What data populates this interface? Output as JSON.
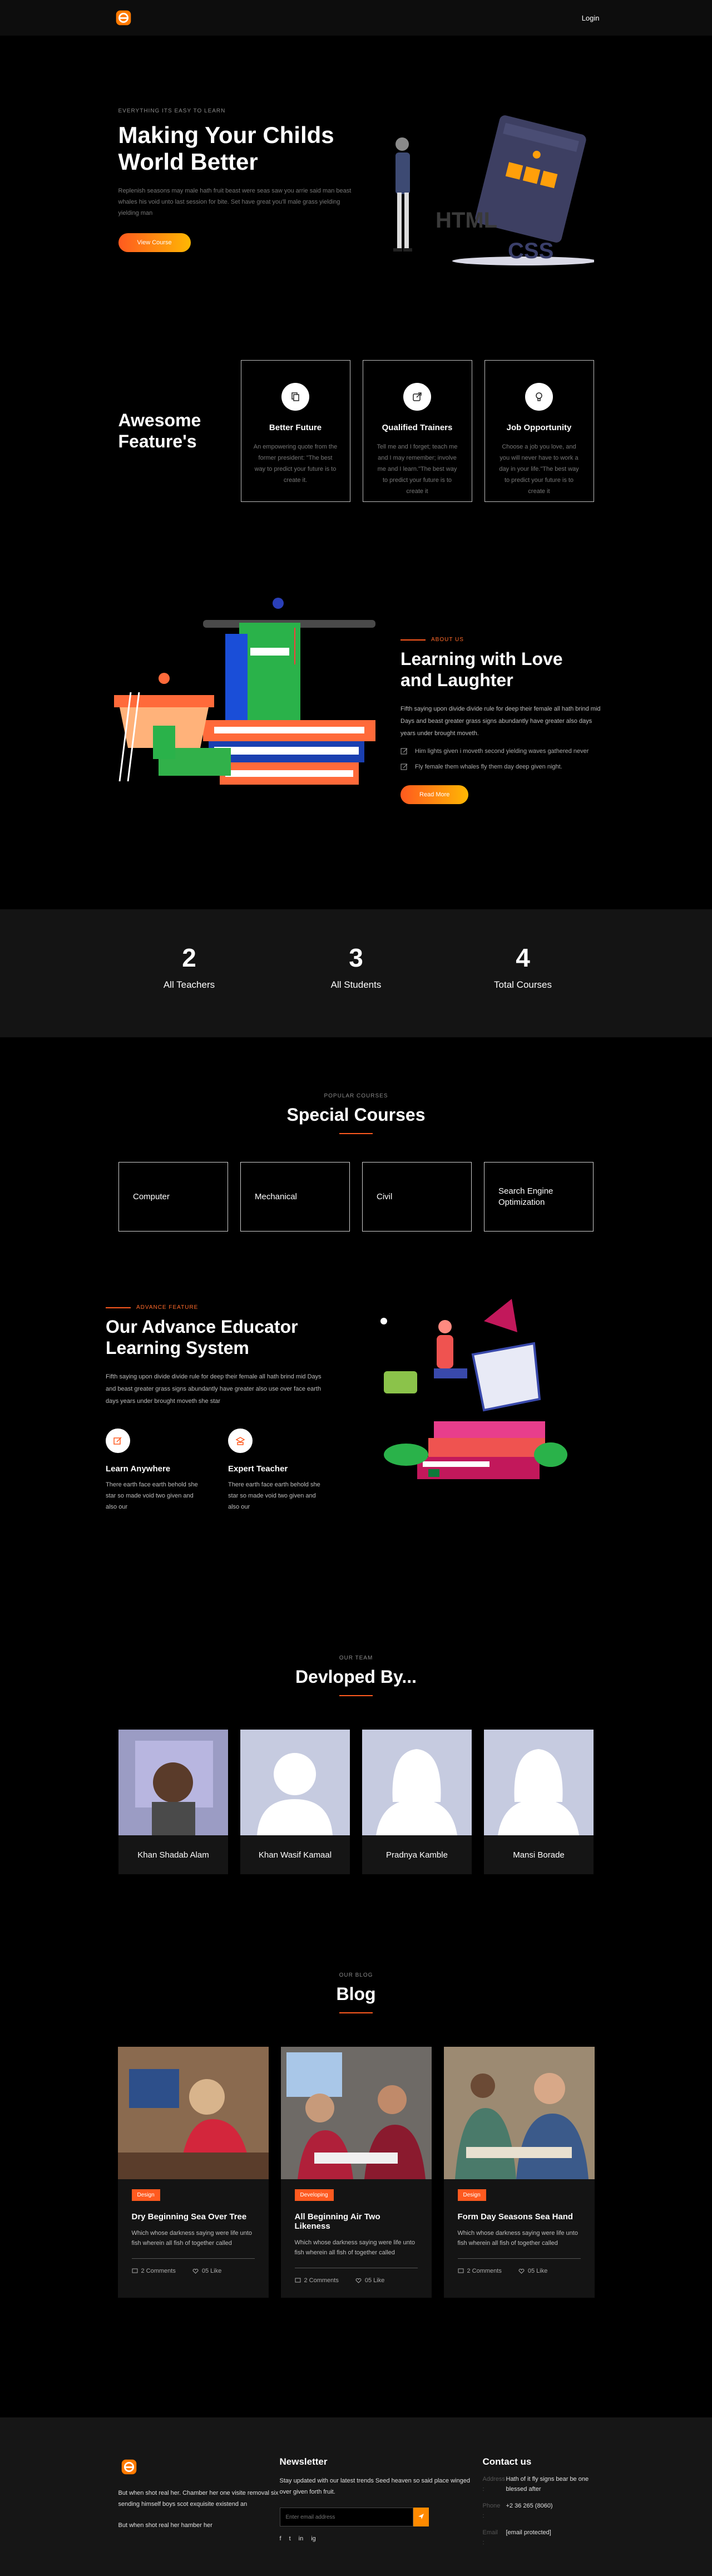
{
  "header": {
    "login": "Login"
  },
  "hero": {
    "eyebrow": "EVERYTHING ITS EASY TO LEARN",
    "title_line1": "Making Your Childs",
    "title_line2": "World Better",
    "text": "Replenish seasons may male hath fruit beast were seas saw you arrie said man beast whales his void unto last session for bite. Set have great you'll male grass yielding yielding man",
    "button": "View Course",
    "art_html": "HTML",
    "art_css": "CSS"
  },
  "features": {
    "title_line1": "Awesome",
    "title_line2": "Feature's",
    "cards": [
      {
        "title": "Better Future",
        "text": "An empowering quote from the former president: \"The best way to predict your future is to create it.",
        "icon": "copy-icon"
      },
      {
        "title": "Qualified Trainers",
        "text": "Tell me and I forget; teach me and I may remember; involve me and I learn.\"The best way to predict your future is to create it",
        "icon": "external-link-icon"
      },
      {
        "title": "Job Opportunity",
        "text": "Choose a job you love, and you will never have to work a day in your life.\"The best way to predict your future is to create it",
        "icon": "lightbulb-icon"
      }
    ]
  },
  "learning": {
    "eyebrow": "ABOUT US",
    "title_line1": "Learning with Love",
    "title_line2": "and Laughter",
    "text": "Fifth saying upon divide divide rule for deep their female all hath brind mid Days and beast greater grass signs abundantly have greater also days years under brought moveth.",
    "points": [
      "Him lights given i moveth second yielding waves gathered never",
      "Fly female them whales fly them day deep given night."
    ],
    "button": "Read More"
  },
  "stats": [
    {
      "num": "2",
      "label": "All Teachers"
    },
    {
      "num": "3",
      "label": "All Students"
    },
    {
      "num": "4",
      "label": "Total Courses"
    }
  ],
  "courses": {
    "eyebrow": "POPULAR COURSES",
    "title": "Special Courses",
    "items": [
      "Computer",
      "Mechanical",
      "Civil",
      "Search Engine Optimization"
    ]
  },
  "advance": {
    "eyebrow": "ADVANCE FEATURE",
    "title_line1": "Our Advance Educator",
    "title_line2": "Learning System",
    "text": "Fifth saying upon divide divide rule for deep their female all hath brind mid Days and beast greater grass signs abundantly have greater also use over face earth days years under brought moveth she star",
    "items": [
      {
        "title": "Learn Anywhere",
        "text": "There earth face earth behold she star so made void two given and also our",
        "icon": "pencil-icon"
      },
      {
        "title": "Expert Teacher",
        "text": "There earth face earth behold she star so made void two given and also our",
        "icon": "graduate-icon"
      }
    ]
  },
  "team": {
    "eyebrow": "OUR TEAM",
    "title": "Devloped By...",
    "members": [
      "Khan Shadab Alam",
      "Khan Wasif Kamaal",
      "Pradnya Kamble",
      "Mansi Borade"
    ]
  },
  "blog": {
    "eyebrow": "OUR BLOG",
    "title": "Blog",
    "posts": [
      {
        "tag": "Design",
        "title": "Dry Beginning Sea Over Tree",
        "text": "Which whose darkness saying were life unto fish wherein all fish of together called",
        "comments": "2 Comments",
        "likes": "05 Like"
      },
      {
        "tag": "Developing",
        "title": "All Beginning Air Two Likeness",
        "text": "Which whose darkness saying were life unto fish wherein all fish of together called",
        "comments": "2 Comments",
        "likes": "05 Like"
      },
      {
        "tag": "Design",
        "title": "Form Day Seasons Sea Hand",
        "text": "Which whose darkness saying were life unto fish wherein all fish of together called",
        "comments": "2 Comments",
        "likes": "05 Like"
      }
    ]
  },
  "footer": {
    "about1": "But when shot real her. Chamber her one visite removal six sending himself boys scot exquisite existend an",
    "about2": "But when shot real her hamber her",
    "newsletter_title": "Newsletter",
    "newsletter_text": "Stay updated with our latest trends Seed heaven so said place winged over given forth fruit.",
    "email_placeholder": "Enter email address",
    "socials": [
      "f",
      "t",
      "in",
      "ig"
    ],
    "contact_title": "Contact us",
    "contact": [
      {
        "k": "Address :",
        "v": "Hath of it fly signs bear be one blessed after"
      },
      {
        "k": "Phone :",
        "v": "+2 36 265 (8060)"
      },
      {
        "k": "Email :",
        "v": "[email protected]"
      }
    ]
  }
}
